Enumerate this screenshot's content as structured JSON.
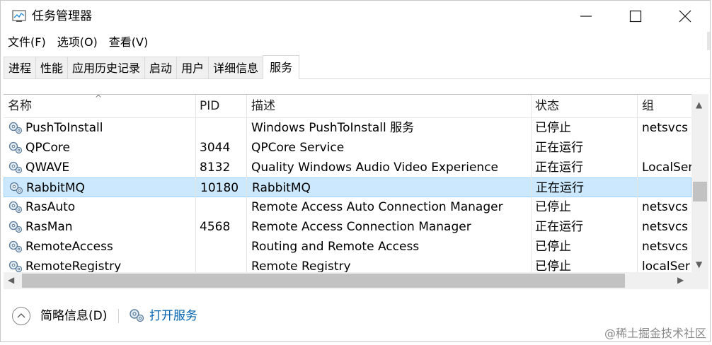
{
  "window": {
    "title": "任务管理器",
    "accent": "#0063b1",
    "selected_bg": "#cce8ff"
  },
  "menu": [
    "文件(F)",
    "选项(O)",
    "查看(V)"
  ],
  "tabs": [
    "进程",
    "性能",
    "应用历史记录",
    "启动",
    "用户",
    "详细信息",
    "服务"
  ],
  "active_tab": "服务",
  "table": {
    "columns": {
      "name": "名称",
      "pid": "PID",
      "desc": "描述",
      "status": "状态",
      "group": "组"
    },
    "rows": [
      {
        "name": "PushToInstall",
        "pid": "",
        "desc": "Windows PushToInstall 服务",
        "status": "已停止",
        "group": "netsvcs"
      },
      {
        "name": "QPCore",
        "pid": "3044",
        "desc": "QPCore Service",
        "status": "正在运行",
        "group": ""
      },
      {
        "name": "QWAVE",
        "pid": "8132",
        "desc": "Quality Windows Audio Video Experience",
        "status": "正在运行",
        "group": "LocalSer"
      },
      {
        "name": "RabbitMQ",
        "pid": "10180",
        "desc": "RabbitMQ",
        "status": "正在运行",
        "group": ""
      },
      {
        "name": "RasAuto",
        "pid": "",
        "desc": "Remote Access Auto Connection Manager",
        "status": "已停止",
        "group": "netsvcs"
      },
      {
        "name": "RasMan",
        "pid": "4568",
        "desc": "Remote Access Connection Manager",
        "status": "正在运行",
        "group": "netsvcs"
      },
      {
        "name": "RemoteAccess",
        "pid": "",
        "desc": "Routing and Remote Access",
        "status": "已停止",
        "group": "netsvcs"
      },
      {
        "name": "RemoteRegistry",
        "pid": "",
        "desc": "Remote Registry",
        "status": "已停止",
        "group": "localSer"
      }
    ]
  },
  "footer": {
    "brief": "简略信息(D)",
    "open_services": "打开服务"
  },
  "watermark": "@稀土掘金技术社区",
  "icons": {
    "app": "task-manager-icon",
    "service": "service-gear-icon",
    "collapse": "chevron-up-icon"
  }
}
